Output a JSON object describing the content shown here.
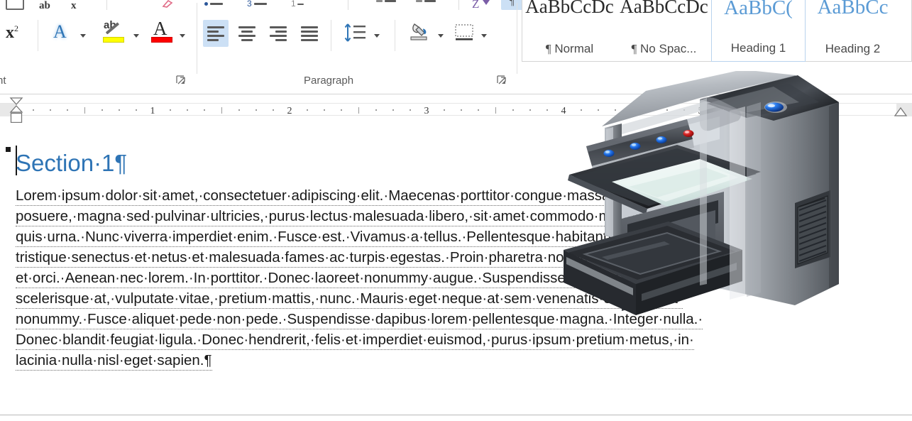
{
  "ribbon": {
    "groups": [
      {
        "label": "nt",
        "launcher": "dialog-launcher"
      },
      {
        "label": "Paragraph",
        "launcher": "dialog-launcher"
      }
    ],
    "font_group": {
      "superscript_label": "x",
      "superscript_exponent": "2",
      "text_effects_glyph": "A",
      "highlight_glyph": "ab",
      "highlight_color": "#ffff00",
      "font_color_glyph": "A",
      "font_color": "#ff0000"
    },
    "paragraph_group": {
      "align_left": "Align Left",
      "align_center": "Center",
      "align_right": "Align Right",
      "justify": "Justify",
      "line_spacing": "Line and Paragraph Spacing",
      "shading": "Shading",
      "borders": "Borders",
      "bullets": "Bullets",
      "numbering": "Numbering",
      "multilevel": "Multilevel List",
      "decrease_indent": "Decrease Indent",
      "increase_indent": "Increase Indent",
      "sort": "Sort",
      "show_marks": "Show/Hide Formatting Marks",
      "show_marks_glyph": "¶",
      "sort_glyph": "Z"
    },
    "selected_alignment": "align-left",
    "accent_color": "#cce0f5"
  },
  "styles_gallery": {
    "items": [
      {
        "preview": "AaBbCcDc",
        "name": "Normal",
        "pilcrow": "¶",
        "heading": false,
        "active": false
      },
      {
        "preview": "AaBbCcDc",
        "name": "No Spac...",
        "pilcrow": "¶",
        "heading": false,
        "active": false
      },
      {
        "preview": "AaBbC(",
        "name": "Heading 1",
        "pilcrow": "",
        "heading": true,
        "active": true
      },
      {
        "preview": "AaBbCc",
        "name": "Heading 2",
        "pilcrow": "",
        "heading": true,
        "active": false
      }
    ]
  },
  "ruler": {
    "numbers": [
      "1",
      "2",
      "3",
      "4",
      "5"
    ],
    "left_indent_marker": "first-line-indent-marker",
    "right_indent_marker": "right-indent-marker",
    "unit": "inches"
  },
  "document": {
    "heading": "Section·1¶",
    "heading_color": "#2e74b5",
    "lines": [
      "Lorem·ipsum·dolor·sit·amet,·consectetuer·adipiscing·elit.·Maecenas·porttitor·congue·massa.·Fusce·",
      "posuere,·magna·sed·pulvinar·ultricies,·purus·lectus·malesuada·libero,·sit·amet·commodo·magna·eros·",
      "quis·urna.·Nunc·viverra·imperdiet·enim.·Fusce·est.·Vivamus·a·tellus.·Pellentesque·habitant·morbi·",
      "tristique·senectus·et·netus·et·malesuada·fames·ac·turpis·egestas.·Proin·pharetra·nonummy·pede.·Mauris·",
      "et·orci.·Aenean·nec·lorem.·In·porttitor.·Donec·laoreet·nonummy·augue.·Suspendisse·dui·purus,·",
      "scelerisque·at,·vulputate·vitae,·pretium·mattis,·nunc.·Mauris·eget·neque·at·sem·venenatis·eleifend.·Ut·",
      "nonummy.·Fusce·aliquet·pede·non·pede.·Suspendisse·dapibus·lorem·pellentesque·magna.·Integer·nulla.·",
      "Donec·blandit·feugiat·ligula.·Donec·hendrerit,·felis·et·imperdiet·euismod,·purus·ipsum·pretium·metus,·in·",
      "lacinia·nulla·nisl·eget·sapien.¶"
    ],
    "style_area_marker": "heading-style-marker",
    "cursor": "text-insertion-caret"
  },
  "printer_image": {
    "alt": "multifunction printer copier clip art",
    "leds": [
      "#2f6fe0",
      "#2f6fe0",
      "#2f6fe0",
      "#d02020"
    ],
    "power_led": "#1a5fe0",
    "body_color": "#a9adb2",
    "dark_color": "#3a3d42",
    "paper_color": "#dff0ec"
  }
}
